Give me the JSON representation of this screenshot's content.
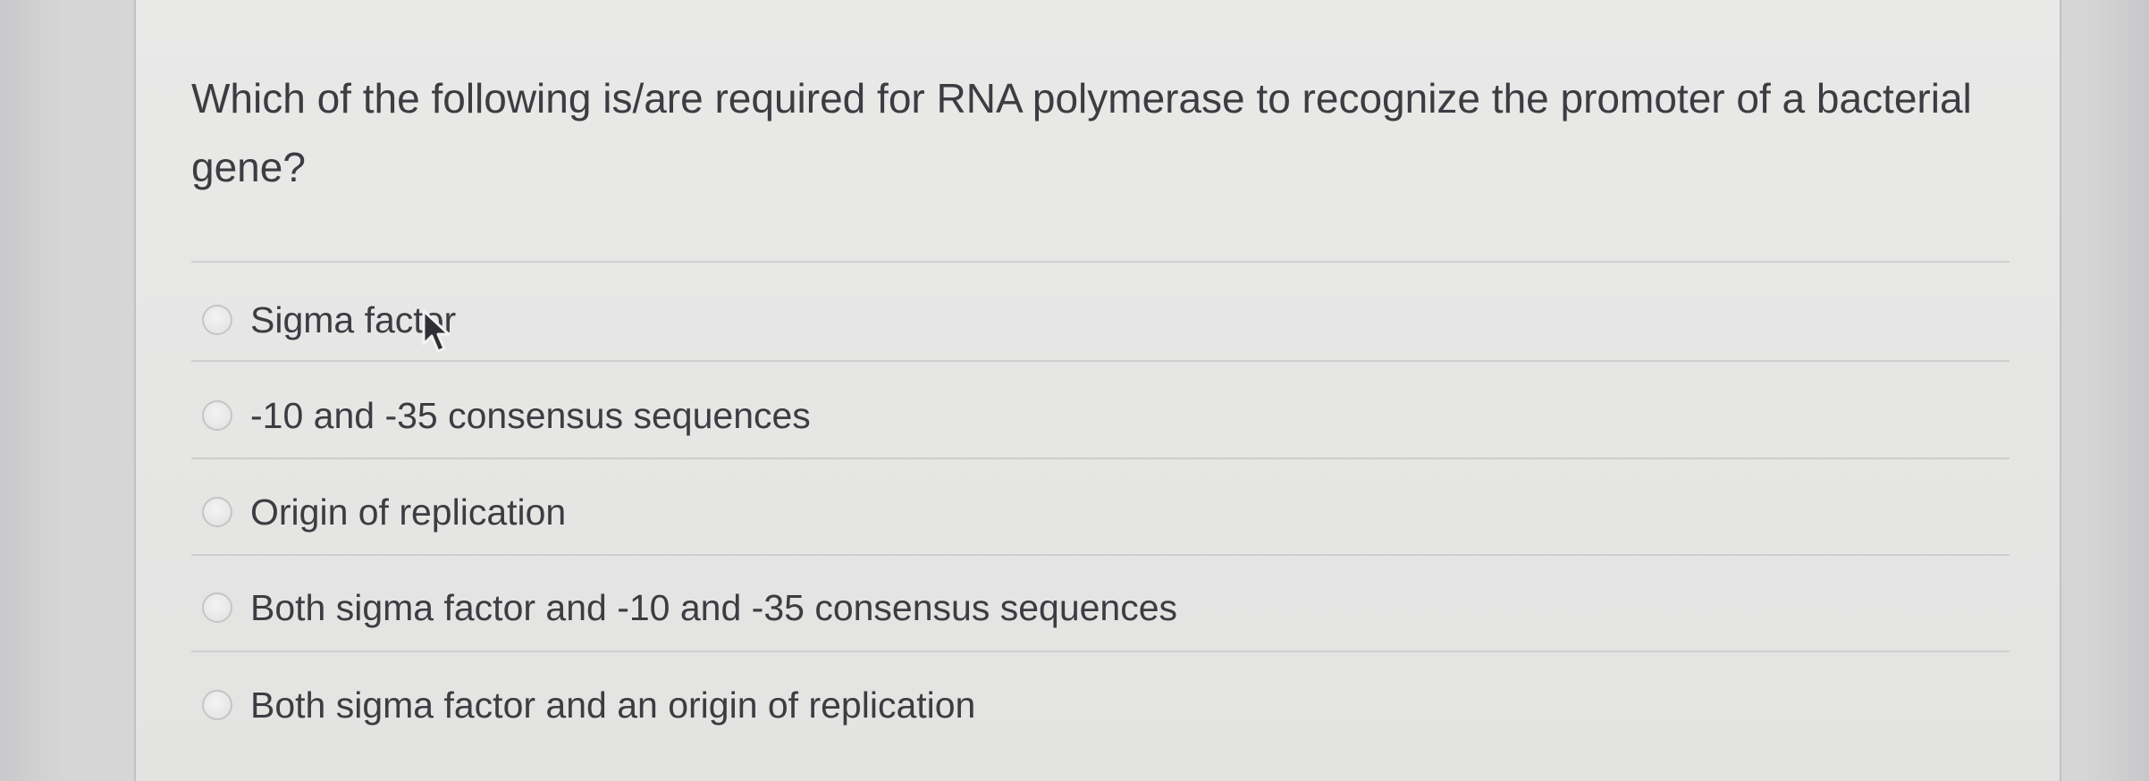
{
  "question": {
    "text": "Which of the following is/are required for RNA polymerase to recognize the promoter of a bacterial gene?"
  },
  "options": [
    {
      "label": "Sigma factor",
      "selected": false
    },
    {
      "label": "-10 and -35 consensus sequences",
      "selected": false
    },
    {
      "label": "Origin of replication",
      "selected": false
    },
    {
      "label": "Both sigma factor and -10 and -35 consensus sequences",
      "selected": false
    },
    {
      "label": "Both sigma factor and an origin of replication",
      "selected": false
    }
  ],
  "icons": {
    "radio": "radio-unselected-icon",
    "cursor": "mouse-pointer-icon"
  },
  "colors": {
    "background": "#d6d6d7",
    "card": "#e7e7e6",
    "text": "#3c3c42",
    "divider": "#cfcfcf"
  }
}
